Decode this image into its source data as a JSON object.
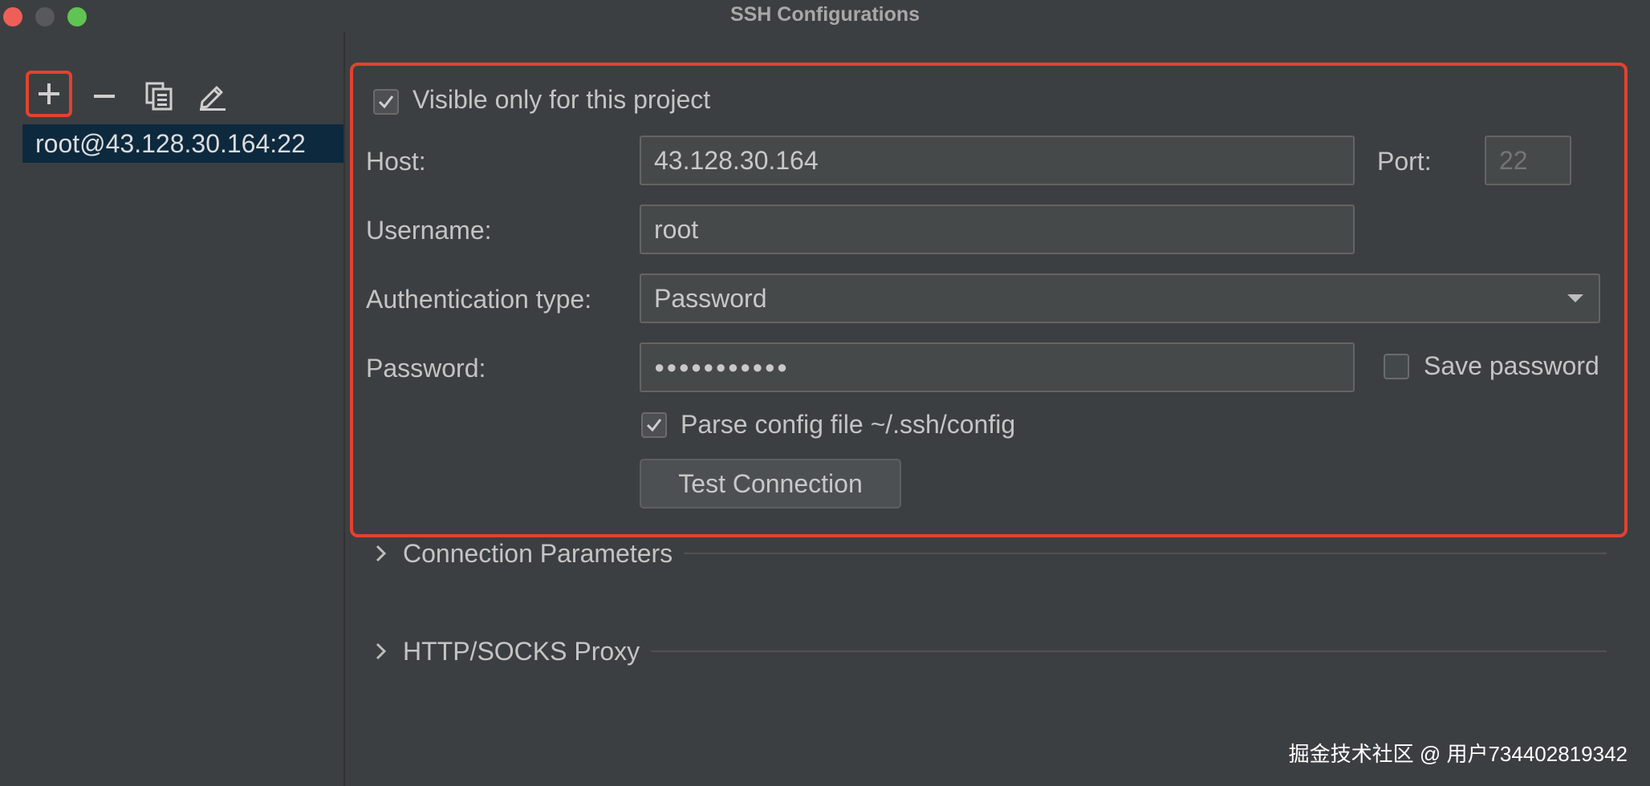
{
  "window": {
    "title": "SSH Configurations"
  },
  "toolbar": {
    "add_icon": "plus-icon",
    "remove_icon": "minus-icon",
    "copy_icon": "copy-icon",
    "edit_icon": "pencil-icon"
  },
  "config_list": [
    {
      "label": "root@43.128.30.164:22",
      "selected": true
    }
  ],
  "form": {
    "visible_only": {
      "label": "Visible only for this project",
      "checked": true
    },
    "host": {
      "label": "Host:",
      "value": "43.128.30.164"
    },
    "port": {
      "label": "Port:",
      "placeholder": "22"
    },
    "username": {
      "label": "Username:",
      "value": "root"
    },
    "auth_type": {
      "label": "Authentication type:",
      "value": "Password"
    },
    "password": {
      "label": "Password:",
      "value": "●●●●●●●●●●●"
    },
    "save_password": {
      "label": "Save password",
      "checked": false
    },
    "parse_config": {
      "label": "Parse config file ~/.ssh/config",
      "checked": true
    },
    "test_button": "Test Connection"
  },
  "sections": [
    {
      "title": "Connection Parameters",
      "expanded": false
    },
    {
      "title": "HTTP/SOCKS Proxy",
      "expanded": false
    }
  ],
  "watermark": "掘金技术社区 @ 用户734402819342",
  "colors": {
    "highlight_border": "#e2422f",
    "selection": "#0d293e"
  }
}
